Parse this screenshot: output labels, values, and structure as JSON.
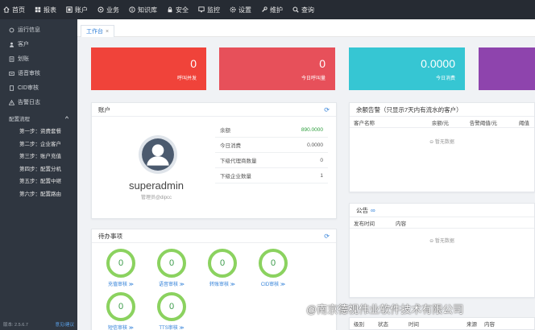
{
  "topnav": [
    {
      "label": "首页",
      "icon": "home-icon"
    },
    {
      "label": "报表",
      "icon": "grid-icon"
    },
    {
      "label": "账户",
      "icon": "account-icon"
    },
    {
      "label": "业务",
      "icon": "cloud-icon"
    },
    {
      "label": "知识库",
      "icon": "info-icon"
    },
    {
      "label": "安全",
      "icon": "lock-icon"
    },
    {
      "label": "监控",
      "icon": "monitor-icon"
    },
    {
      "label": "设置",
      "icon": "gear-icon"
    },
    {
      "label": "维护",
      "icon": "wrench-icon"
    },
    {
      "label": "查询",
      "icon": "search-icon"
    }
  ],
  "sidebar": {
    "items": [
      {
        "label": "运行信息",
        "icon": "circle-icon"
      },
      {
        "label": "客户",
        "icon": "user-icon"
      },
      {
        "label": "划账",
        "icon": "transfer-icon"
      },
      {
        "label": "语音审核",
        "icon": "voice-icon"
      },
      {
        "label": "CID审核",
        "icon": "doc-icon"
      },
      {
        "label": "告警日志",
        "icon": "warning-icon"
      }
    ],
    "group_label": "配置流程",
    "steps": [
      "第一步：资费套餐",
      "第二步：企业客户",
      "第三步：账户充值",
      "第四步：配置分机",
      "第五步：配置中继",
      "第六步：配置路由"
    ],
    "version": "版本: 2.5.6.7",
    "footer_link": "意见/建议"
  },
  "tabs": [
    {
      "label": "工作台"
    }
  ],
  "stats": [
    {
      "value": "0",
      "label": "呼叫并发",
      "color": "#f0433a"
    },
    {
      "value": "0",
      "label": "今日呼叫量",
      "color": "#e7505a"
    },
    {
      "value": "0.0000",
      "label": "今日消费",
      "color": "#36c6d3"
    },
    {
      "value": "",
      "label": "",
      "color": "#8e44ad"
    }
  ],
  "account": {
    "title": "账户",
    "username": "superadmin",
    "role": "管理员@dipcc",
    "rows": [
      {
        "label": "余额",
        "value": "890.0000"
      },
      {
        "label": "今日消费",
        "value": "0.0000"
      },
      {
        "label": "下级代理商数量",
        "value": "0"
      },
      {
        "label": "下级企业数量",
        "value": "1"
      }
    ]
  },
  "alert": {
    "title": "余额告警（只显示7天内有流水的客户）",
    "columns": [
      "客户名称",
      "余额/元",
      "告警阈值/元",
      "阈值"
    ],
    "empty": "暂无数据"
  },
  "notice": {
    "title": "公告",
    "columns": [
      "发布时间",
      "内容"
    ],
    "empty": "暂无数据"
  },
  "todo": {
    "title": "待办事项",
    "items": [
      {
        "count": "0",
        "label": "充值审核 ≫"
      },
      {
        "count": "0",
        "label": "语音审核 ≫"
      },
      {
        "count": "0",
        "label": "转账审核 ≫"
      },
      {
        "count": "0",
        "label": "CID审核 ≫"
      },
      {
        "count": "0",
        "label": "短信审核 ≫"
      },
      {
        "count": "0",
        "label": "TTS审核 ≫"
      }
    ]
  },
  "log": {
    "columns": [
      "级别",
      "状态",
      "时间",
      "来源",
      "内容"
    ]
  },
  "watermark": "@南京德视伟业软件技术有限公司"
}
